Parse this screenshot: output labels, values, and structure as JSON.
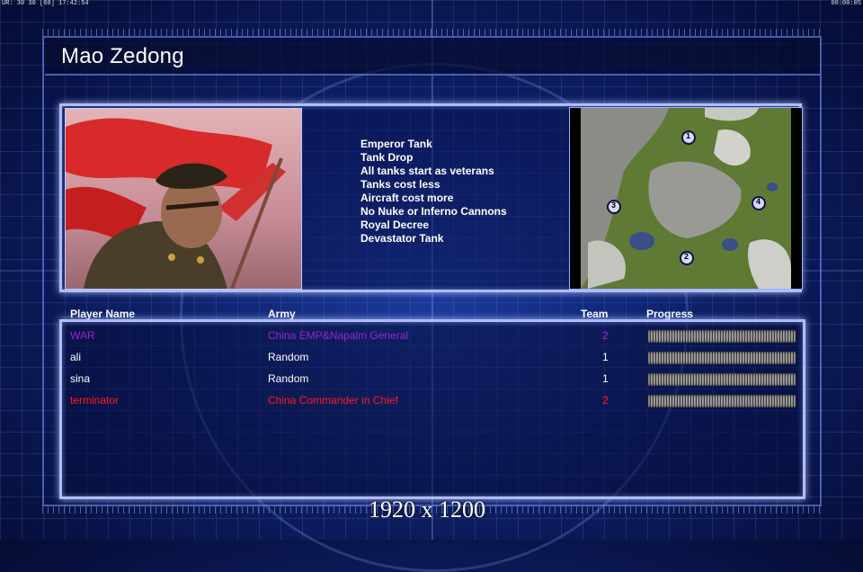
{
  "hud": {
    "top_left": "UR: 30 30 [60] 17:42:54",
    "top_right": "00:00:05"
  },
  "header": {
    "title": "Mao Zedong"
  },
  "general": {
    "features": [
      "Emperor Tank",
      "Tank Drop",
      "All tanks start as veterans",
      "Tanks cost less",
      "Aircraft cost more",
      "No Nuke or Inferno Cannons",
      "Royal Decree",
      "Devastator Tank"
    ]
  },
  "minimap": {
    "start_positions": [
      "1",
      "2",
      "3",
      "4"
    ]
  },
  "players_table": {
    "columns": {
      "name": "Player Name",
      "army": "Army",
      "team": "Team",
      "progress": "Progress"
    },
    "rows": [
      {
        "name": "WAR",
        "army": "China EMP&Napalm General",
        "team": "2",
        "color": "#a020d0"
      },
      {
        "name": "ali",
        "army": "Random",
        "team": "1",
        "color": "#ffffff"
      },
      {
        "name": "sina",
        "army": "Random",
        "team": "1",
        "color": "#ffffff"
      },
      {
        "name": "terminator",
        "army": "China Commander in Chief",
        "team": "2",
        "color": "#ff1a1a"
      }
    ]
  },
  "overlay": {
    "resolution": "1920 x 1200"
  }
}
